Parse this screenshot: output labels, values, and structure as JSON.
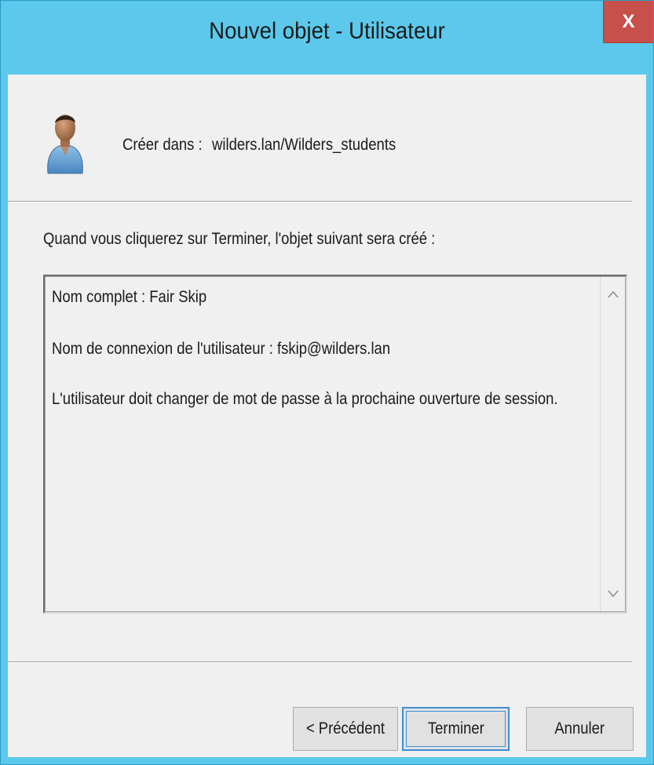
{
  "window": {
    "title": "Nouvel objet - Utilisateur",
    "close_label": "X"
  },
  "header": {
    "create_in_label": "Créer dans :",
    "create_in_value": "wilders.lan/Wilders_students"
  },
  "intro_text": "Quand vous cliquerez sur Terminer, l'objet suivant sera créé :",
  "summary": {
    "lines": [
      "Nom complet : Fair Skip",
      "Nom de connexion de l'utilisateur : fskip@wilders.lan",
      "L'utilisateur doit changer de mot de passe à la prochaine ouverture de session."
    ]
  },
  "buttons": {
    "previous": "< Précédent",
    "finish": "Terminer",
    "cancel": "Annuler"
  },
  "icons": {
    "user": "user-icon",
    "scroll_up": "chevron-up-icon",
    "scroll_down": "chevron-down-icon"
  },
  "colors": {
    "titlebar": "#5bc8ec",
    "close_button": "#c7504a",
    "client_bg": "#f0f0f0",
    "focus_border": "#3c8fd6"
  }
}
